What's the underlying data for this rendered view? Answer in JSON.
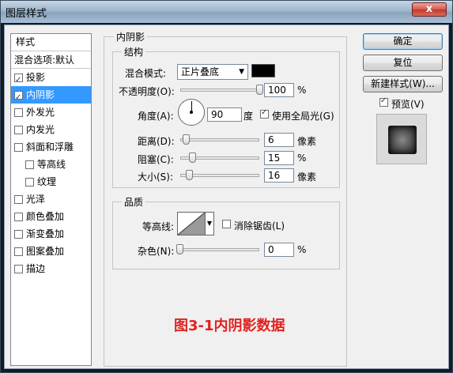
{
  "window": {
    "title": "图层样式",
    "close_glyph": "x"
  },
  "styles_list": {
    "header": "样式",
    "blend_options": "混合选项:默认",
    "items": [
      {
        "label": "投影",
        "checked": true
      },
      {
        "label": "内阴影",
        "checked": true,
        "selected": true
      },
      {
        "label": "外发光",
        "checked": false
      },
      {
        "label": "内发光",
        "checked": false
      },
      {
        "label": "斜面和浮雕",
        "checked": false
      },
      {
        "label": "等高线",
        "checked": false,
        "sub": true
      },
      {
        "label": "纹理",
        "checked": false,
        "sub": true
      },
      {
        "label": "光泽",
        "checked": false
      },
      {
        "label": "颜色叠加",
        "checked": false
      },
      {
        "label": "渐变叠加",
        "checked": false
      },
      {
        "label": "图案叠加",
        "checked": false
      },
      {
        "label": "描边",
        "checked": false
      }
    ]
  },
  "inner_shadow": {
    "section_title": "内阴影",
    "structure": {
      "title": "结构",
      "blend_mode_label": "混合模式:",
      "blend_mode_value": "正片叠底",
      "shadow_color": "#000000",
      "opacity_label": "不透明度(O):",
      "opacity_value": "100",
      "opacity_unit": "%",
      "angle_label": "角度(A):",
      "angle_value": "90",
      "angle_unit": "度",
      "global_light_label": "使用全局光(G)",
      "global_light_checked": true,
      "distance_label": "距离(D):",
      "distance_value": "6",
      "distance_unit": "像素",
      "choke_label": "阻塞(C):",
      "choke_value": "15",
      "choke_unit": "%",
      "size_label": "大小(S):",
      "size_value": "16",
      "size_unit": "像素"
    },
    "quality": {
      "title": "品质",
      "contour_label": "等高线:",
      "anti_alias_label": "消除锯齿(L)",
      "anti_alias_checked": false,
      "noise_label": "杂色(N):",
      "noise_value": "0",
      "noise_unit": "%"
    }
  },
  "buttons": {
    "ok": "确定",
    "reset": "复位",
    "new_style": "新建样式(W)...",
    "preview_label": "预览(V)",
    "preview_checked": true
  },
  "caption": "图3-1内阴影数据"
}
